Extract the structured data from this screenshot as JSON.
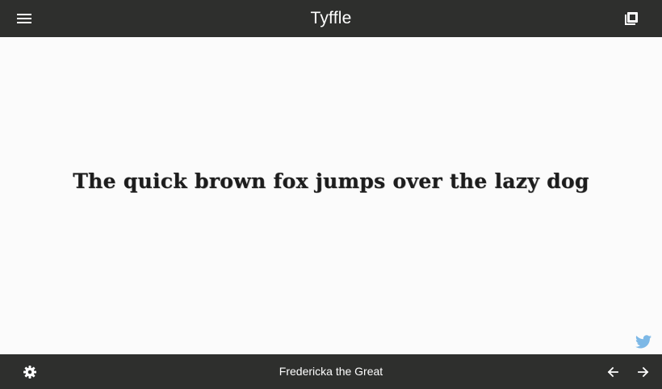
{
  "header": {
    "title": "Tyffle",
    "menu_icon": "menu-icon",
    "collection_icon": "collection-icon"
  },
  "main": {
    "sample_text": "The quick brown fox jumps over the lazy dog",
    "share_icon": "twitter-icon"
  },
  "footer": {
    "font_name": "Fredericka the Great",
    "settings_icon": "gear-icon",
    "prev_icon": "arrow-left-icon",
    "next_icon": "arrow-right-icon"
  },
  "colors": {
    "bar_background": "#2e2f2d",
    "page_background": "#fbfbfb",
    "twitter_blue": "#7db8e6"
  }
}
